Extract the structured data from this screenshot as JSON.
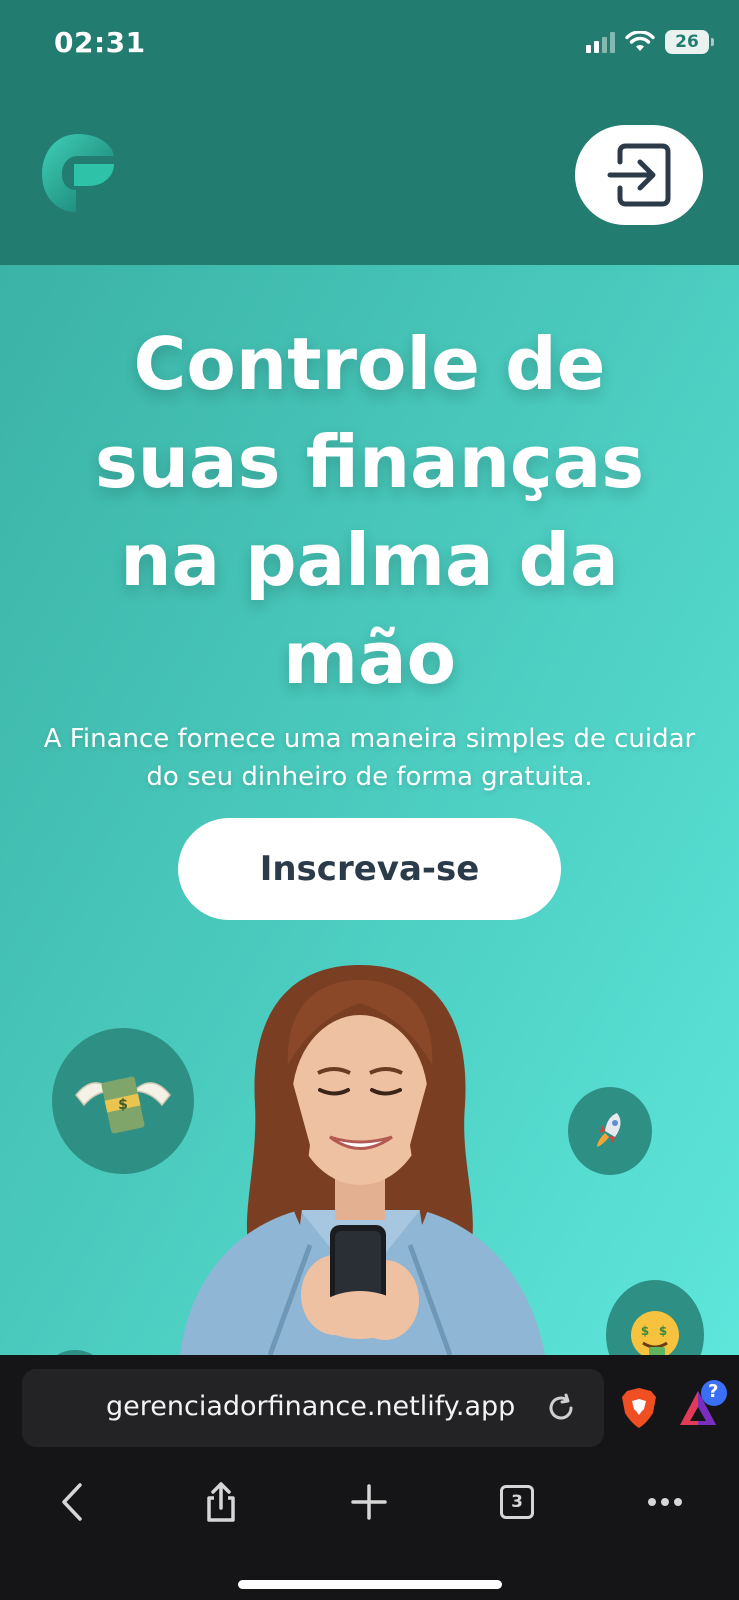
{
  "status_bar": {
    "time": "02:31",
    "battery": "26",
    "icons": [
      "signal-icon",
      "wifi-icon",
      "battery-icon"
    ]
  },
  "header": {
    "logo_icon": "finance-logo-icon",
    "login_icon": "sign-in-icon"
  },
  "hero": {
    "title": "Controle de suas finanças na palma da mão",
    "subtitle": "A Finance fornece uma maneira simples de cuidar do seu dinheiro de forma gratuita.",
    "cta_label": "Inscreva-se",
    "decorations": [
      "money-with-wings-emoji",
      "rocket-emoji",
      "money-mouth-face-emoji"
    ]
  },
  "browser": {
    "url": "gerenciadorfinance.netlify.app",
    "tab_count": "3",
    "rewards_badge": "?",
    "toolbar_icons": [
      "back-icon",
      "share-icon",
      "new-tab-icon",
      "tabs-icon",
      "more-icon"
    ]
  },
  "colors": {
    "header": "#237c70",
    "hero_start": "#3bb3a6",
    "hero_end": "#5ee6db",
    "button_text": "#2c3b4a",
    "browser_bg": "#151517"
  }
}
